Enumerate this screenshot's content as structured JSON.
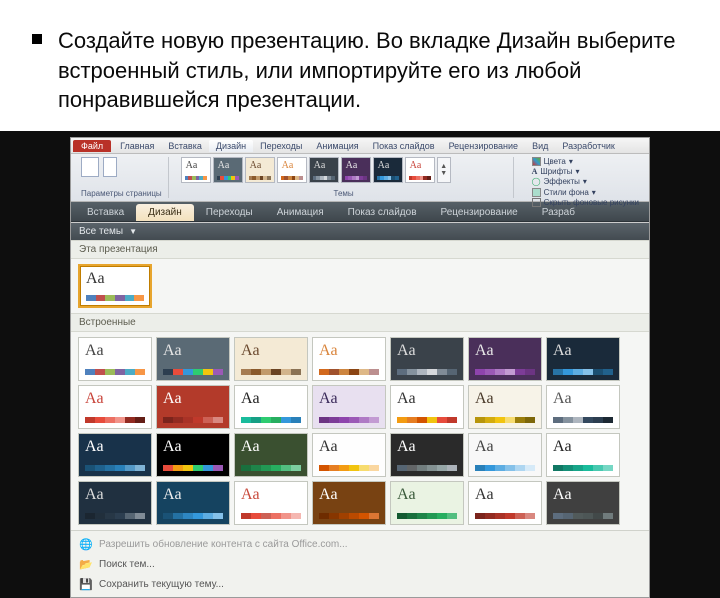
{
  "slide": {
    "bullet_text": "Создайте новую презентацию. Во вкладке Дизайн выберите встроенный стиль, или импортируйте его из любой понравившейся презентации."
  },
  "ribbon": {
    "file": "Файл",
    "top_tabs": [
      "Главная",
      "Вставка",
      "Дизайн",
      "Переходы",
      "Анимация",
      "Показ слайдов",
      "Рецензирование",
      "Вид",
      "Разработчик"
    ],
    "group_page_params": "Параметры страницы",
    "group_themes": "Темы",
    "right_controls": {
      "colors": "Цвета",
      "fonts": "Шрифты",
      "effects": "Эффекты",
      "bg_styles": "Стили фона",
      "hide_bg": "Скрыть фоновые рисунки"
    }
  },
  "sec_tabs": [
    "Вставка",
    "Дизайн",
    "Переходы",
    "Анимация",
    "Показ слайдов",
    "Рецензирование",
    "Разраб"
  ],
  "sec_tabs_active_index": 1,
  "gallery": {
    "all_themes": "Все темы",
    "this_presentation": "Эта презентация",
    "builtin": "Встроенные",
    "this_presentation_themes": [
      {
        "aa_color": "#333333",
        "bg": "#ffffff",
        "palette": [
          "#4f81bd",
          "#c0504d",
          "#9bbb59",
          "#8064a2",
          "#4bacc6",
          "#f79646"
        ]
      }
    ],
    "builtin_themes": [
      {
        "aa_color": "#444444",
        "bg": "#ffffff",
        "palette": [
          "#4f81bd",
          "#c0504d",
          "#9bbb59",
          "#8064a2",
          "#4bacc6",
          "#f79646"
        ]
      },
      {
        "aa_color": "#e6e6e6",
        "bg": "#5a6a75",
        "palette": [
          "#2c3e50",
          "#e74c3c",
          "#3498db",
          "#2ecc71",
          "#f1c40f",
          "#9b59b6"
        ]
      },
      {
        "aa_color": "#6b4a2f",
        "bg": "#f4ead5",
        "palette": [
          "#a67c52",
          "#8b5a2b",
          "#c19a6b",
          "#6b4423",
          "#d2b48c",
          "#8b7355"
        ]
      },
      {
        "aa_color": "#d9843b",
        "bg": "#ffffff",
        "palette": [
          "#d2691e",
          "#a0522d",
          "#cd853f",
          "#8b4513",
          "#deb887",
          "#bc8f8f"
        ]
      },
      {
        "aa_color": "#dddddd",
        "bg": "#3a424a",
        "palette": [
          "#5d6d7e",
          "#85929e",
          "#aeb6bf",
          "#d5d8dc",
          "#808b96",
          "#566573"
        ]
      },
      {
        "aa_color": "#e8e8e8",
        "bg": "#4a2f5a",
        "palette": [
          "#8e44ad",
          "#9b59b6",
          "#af7ac5",
          "#c39bd3",
          "#7d3c98",
          "#6c3483"
        ]
      },
      {
        "aa_color": "#dddddd",
        "bg": "#1a2a3a",
        "palette": [
          "#2874a6",
          "#3498db",
          "#5dade2",
          "#85c1e9",
          "#1b4f72",
          "#21618c"
        ]
      },
      {
        "aa_color": "#c8443a",
        "bg": "#ffffff",
        "palette": [
          "#c0392b",
          "#e74c3c",
          "#ec7063",
          "#f1948a",
          "#922b21",
          "#641e16"
        ]
      },
      {
        "aa_color": "#ffffff",
        "bg": "#b33a2a",
        "palette": [
          "#7b241c",
          "#922b21",
          "#a93226",
          "#c0392b",
          "#cd6155",
          "#d98880"
        ]
      },
      {
        "aa_color": "#222222",
        "bg": "#ffffff",
        "palette": [
          "#1abc9c",
          "#16a085",
          "#2ecc71",
          "#27ae60",
          "#3498db",
          "#2980b9"
        ]
      },
      {
        "aa_color": "#3a2a5a",
        "bg": "#e8e0f0",
        "palette": [
          "#6c3483",
          "#7d3c98",
          "#8e44ad",
          "#9b59b6",
          "#af7ac5",
          "#c39bd3"
        ]
      },
      {
        "aa_color": "#333333",
        "bg": "#ffffff",
        "palette": [
          "#f39c12",
          "#e67e22",
          "#d35400",
          "#f1c40f",
          "#e74c3c",
          "#c0392b"
        ]
      },
      {
        "aa_color": "#4a3a2a",
        "bg": "#f7f3e8",
        "palette": [
          "#b7950b",
          "#d4ac0d",
          "#f1c40f",
          "#f7dc6f",
          "#9a7d0a",
          "#7d6608"
        ]
      },
      {
        "aa_color": "#555555",
        "bg": "#ffffff",
        "palette": [
          "#5d6d7e",
          "#85929e",
          "#aeb6bf",
          "#34495e",
          "#2c3e50",
          "#1c2833"
        ]
      },
      {
        "aa_color": "#ffffff",
        "bg": "#18324a",
        "palette": [
          "#1a5276",
          "#1f618d",
          "#2471a3",
          "#2980b9",
          "#5499c7",
          "#7fb3d5"
        ]
      },
      {
        "aa_color": "#ffffff",
        "bg": "#000000",
        "palette": [
          "#e74c3c",
          "#f39c12",
          "#f1c40f",
          "#2ecc71",
          "#3498db",
          "#9b59b6"
        ]
      },
      {
        "aa_color": "#ffffff",
        "bg": "#3a5030",
        "palette": [
          "#196f3d",
          "#1e8449",
          "#229954",
          "#27ae60",
          "#52be80",
          "#7dcea0"
        ]
      },
      {
        "aa_color": "#333333",
        "bg": "#fefefe",
        "palette": [
          "#d35400",
          "#e67e22",
          "#f39c12",
          "#f1c40f",
          "#f7dc6f",
          "#fad7a0"
        ]
      },
      {
        "aa_color": "#ffffff",
        "bg": "#2a2a2a",
        "palette": [
          "#566573",
          "#626567",
          "#717d7e",
          "#839192",
          "#95a5a6",
          "#abb2b9"
        ]
      },
      {
        "aa_color": "#444444",
        "bg": "#f8f8f8",
        "palette": [
          "#2980b9",
          "#3498db",
          "#5dade2",
          "#85c1e9",
          "#aed6f1",
          "#d6eaf8"
        ]
      },
      {
        "aa_color": "#222222",
        "bg": "#ffffff",
        "palette": [
          "#117864",
          "#148f77",
          "#17a589",
          "#1abc9c",
          "#48c9b0",
          "#76d7c4"
        ]
      },
      {
        "aa_color": "#dddddd",
        "bg": "#203040",
        "palette": [
          "#1b2631",
          "#212f3c",
          "#273746",
          "#2c3e50",
          "#566573",
          "#808b96"
        ]
      },
      {
        "aa_color": "#eeeeee",
        "bg": "#154360",
        "palette": [
          "#1a5276",
          "#2471a3",
          "#2e86c1",
          "#3498db",
          "#5dade2",
          "#85c1e9"
        ]
      },
      {
        "aa_color": "#c94a3b",
        "bg": "#ffffff",
        "palette": [
          "#c0392b",
          "#e74c3c",
          "#cd6155",
          "#ec7063",
          "#f1948a",
          "#f5b7b1"
        ]
      },
      {
        "aa_color": "#ffffff",
        "bg": "#784212",
        "palette": [
          "#6e2c00",
          "#873600",
          "#a04000",
          "#ba4a00",
          "#d35400",
          "#dc7633"
        ]
      },
      {
        "aa_color": "#3a5a3a",
        "bg": "#eaf3e3",
        "palette": [
          "#145a32",
          "#196f3d",
          "#1e8449",
          "#229954",
          "#27ae60",
          "#52be80"
        ]
      },
      {
        "aa_color": "#333333",
        "bg": "#ffffff",
        "palette": [
          "#7b241c",
          "#922b21",
          "#a93226",
          "#c0392b",
          "#cd6155",
          "#d98880"
        ]
      },
      {
        "aa_color": "#ffffff",
        "bg": "#404040",
        "palette": [
          "#5d6d7e",
          "#566573",
          "#515a5a",
          "#4d5656",
          "#424949",
          "#707b7c"
        ]
      }
    ]
  },
  "footer": {
    "enable_updates": "Разрешить обновление контента с сайта Office.com...",
    "browse_themes": "Поиск тем...",
    "save_current": "Сохранить текущую тему..."
  }
}
